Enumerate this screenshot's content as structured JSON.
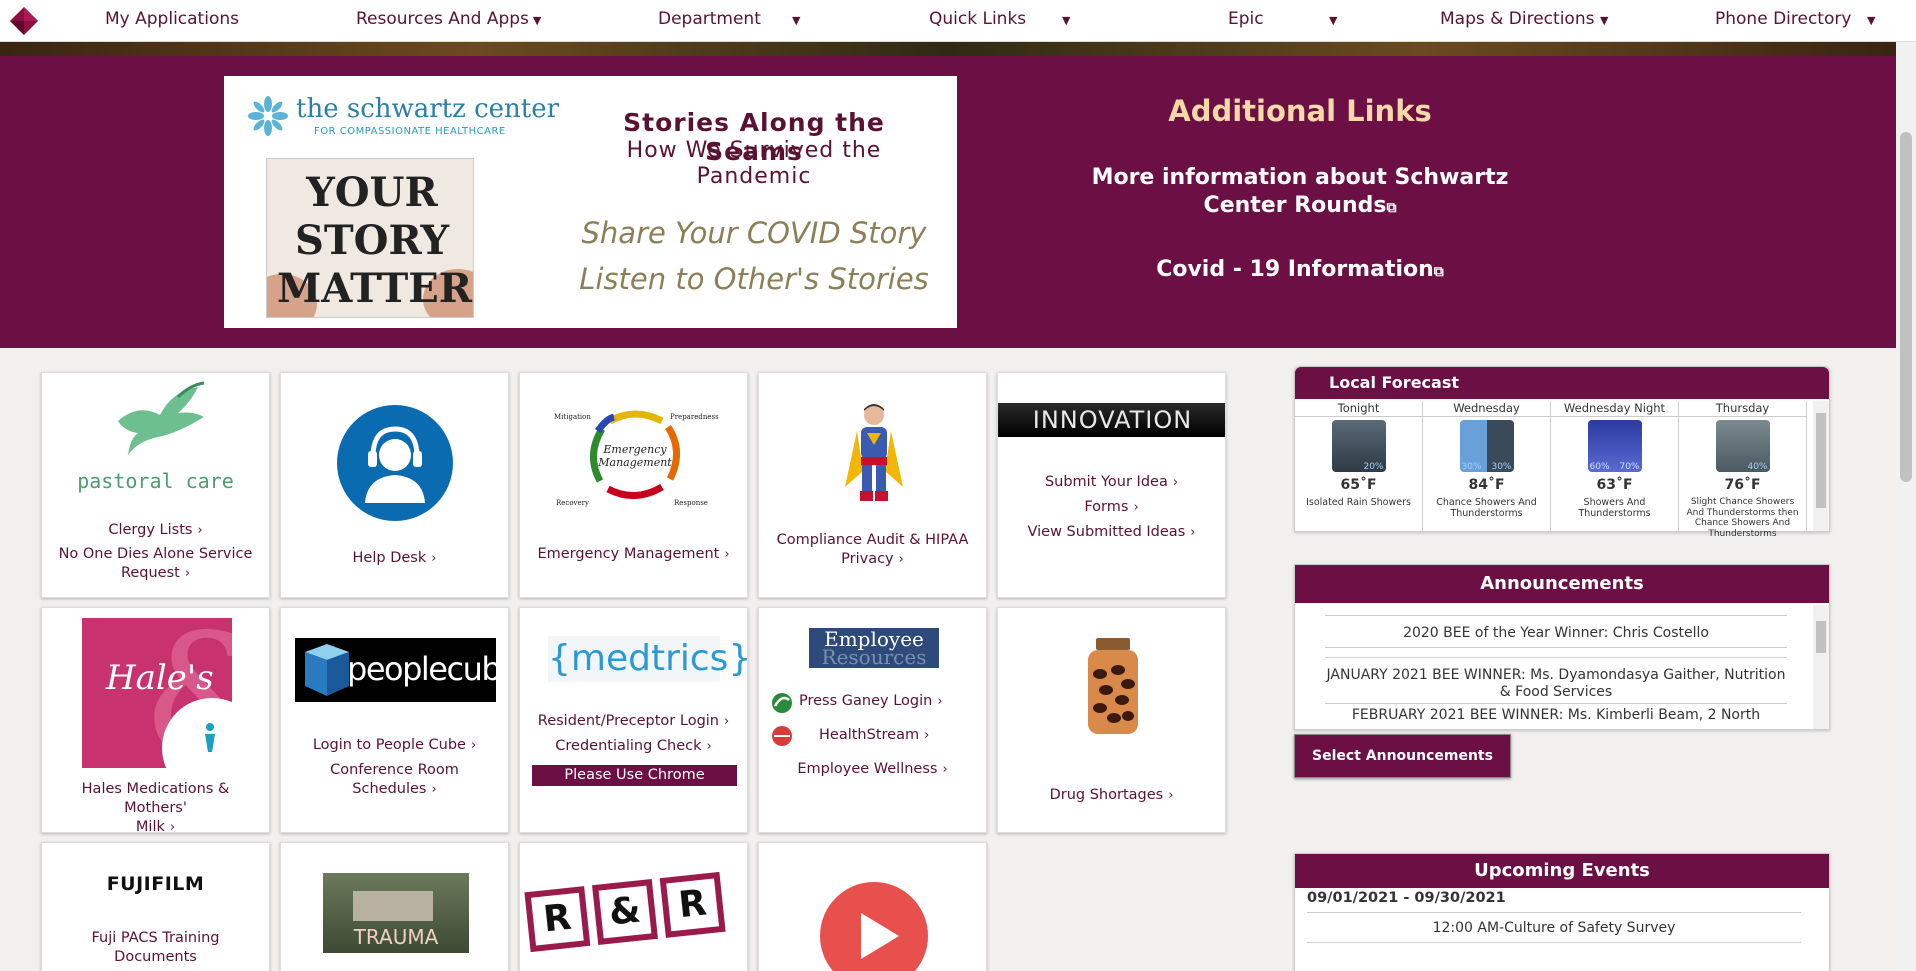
{
  "nav": {
    "items": [
      {
        "label": "My Applications"
      },
      {
        "label": "Resources And Apps"
      },
      {
        "label": "Department"
      },
      {
        "label": "Quick Links"
      },
      {
        "label": "Epic"
      },
      {
        "label": "Maps & Directions"
      },
      {
        "label": "Phone Directory"
      }
    ]
  },
  "banner": {
    "schwartz_name": "the schwartz center",
    "schwartz_tag": "FOR COMPASSIONATE HEALTHCARE",
    "story_image_text": "YOUR STORY MATTERS",
    "title": "Stories Along the Seams",
    "subtitle_1": "How We Survived the",
    "subtitle_2": "Pandemic",
    "italic_1": "Share Your COVID Story",
    "italic_2": "Listen to Other's Stories",
    "additional_links_title": "Additional Links",
    "link_1a": "More information about Schwartz",
    "link_1b": "Center Rounds",
    "link_2": "Covid - 19 Information"
  },
  "tiles": {
    "pastoral_logo": "pastoral care",
    "clergy": "Clergy Lists",
    "no_one_dies_a": "No One Dies Alone Service",
    "no_one_dies_b": "Request",
    "help_desk": "Help Desk",
    "em_center_a": "Emergency",
    "em_center_b": "Management",
    "em_mitigation": "Mitigation",
    "em_preparedness": "Preparedness",
    "em_recovery": "Recovery",
    "em_response": "Response",
    "emergency_mgmt": "Emergency Management",
    "compliance_a": "Compliance Audit & HIPAA",
    "compliance_b": "Privacy",
    "innovation_logo": "INNOVATION",
    "submit_idea": "Submit Your Idea",
    "forms": "Forms",
    "view_ideas": "View Submitted Ideas",
    "hales_logo": "Hale's",
    "hales_a": "Hales Medications & Mothers'",
    "hales_b": "Milk",
    "peoplecube_logo": "peoplecube",
    "login_peoplecube": "Login to People Cube",
    "conf_room": "Conference Room Schedules",
    "medtrics_logo": "{medtrics}",
    "resident_login": "Resident/Preceptor Login",
    "credentialing": "Credentialing Check",
    "use_chrome": "Please Use Chrome",
    "employee_res_a": "Employee",
    "employee_res_b": "Resources",
    "press_ganey": "Press Ganey Login",
    "healthstream": "HealthStream",
    "wellness": "Employee Wellness",
    "drug_shortages": "Drug Shortages",
    "fujifilm_logo": "FUJIFILM",
    "fuji_pacs": "Fuji PACS Training Documents",
    "trauma_label": "TRAUMA",
    "rr_r1": "R",
    "rr_amp": "&",
    "rr_r2": "R"
  },
  "forecast": {
    "title": "Local Forecast",
    "days": [
      {
        "day": "Tonight",
        "temp": "65˚F",
        "desc": "Isolated Rain Showers",
        "pop": "20%"
      },
      {
        "day": "Wednesday",
        "temp": "84˚F",
        "desc": "Chance Showers And Thunderstorms",
        "pop": "30%"
      },
      {
        "day": "Wednesday Night",
        "temp": "63˚F",
        "desc": "Showers And Thunderstorms",
        "pop": "60%"
      },
      {
        "day": "Thursday",
        "temp": "76˚F",
        "desc": "Slight Chance Showers And Thunderstorms then Chance Showers And Thunderstorms",
        "pop": "40%"
      }
    ],
    "pop_extra_wed": "30%",
    "pop_extra_wednight": "70%"
  },
  "announcements": {
    "title": "Announcements",
    "items": [
      "2020 BEE of the Year Winner: Chris Costello",
      "JANUARY 2021 BEE WINNER: Ms. Dyamondasya Gaither, Nutrition & Food Services",
      "FEBRUARY 2021 BEE WINNER: Ms. Kimberli Beam, 2 North"
    ],
    "button": "Select Announcements"
  },
  "events": {
    "title": "Upcoming Events",
    "date_range": "09/01/2021 - 09/30/2021",
    "item": "12:00 AM-Culture of Safety Survey"
  },
  "colors": {
    "brand": "#6b0f44",
    "accent": "#f5d9a8"
  }
}
